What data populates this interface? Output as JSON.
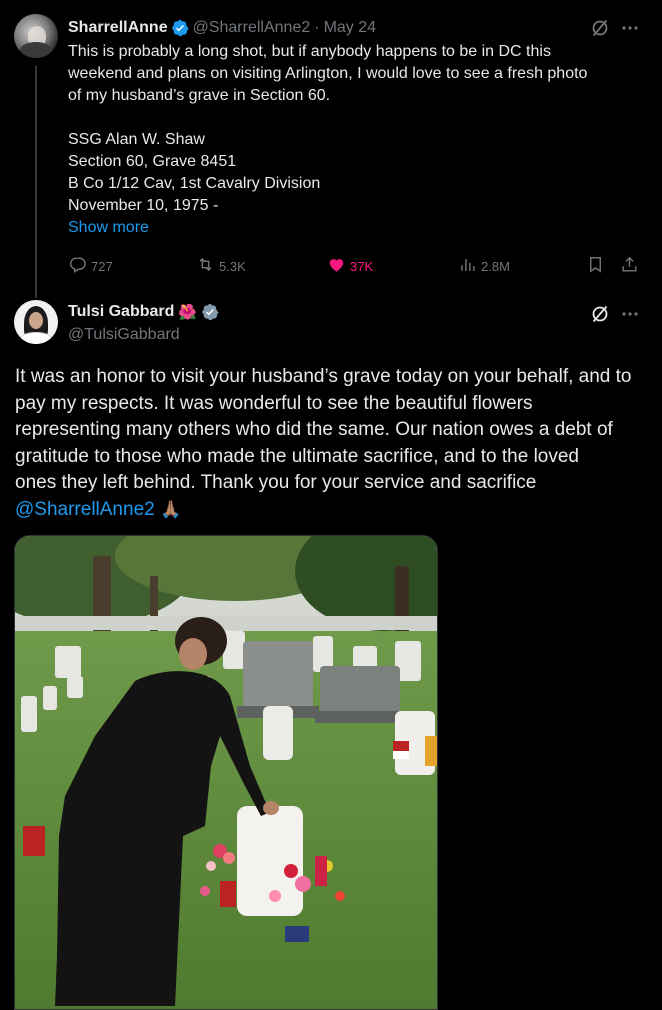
{
  "parent": {
    "name": "SharrellAnne",
    "handle": "@SharrellAnne2",
    "separator": "·",
    "date": "May 24",
    "lines": [
      "This is probably a long shot, but if anybody happens to be in DC this",
      "weekend and plans on visiting Arlington, I would love to see a fresh photo",
      "of my husband’s grave in Section 60."
    ],
    "details": [
      "SSG Alan W. Shaw",
      "Section 60, Grave 8451",
      "B Co 1/12 Cav, 1st Cavalry Division",
      "November 10, 1975 -"
    ],
    "show_more": "Show more",
    "stats": {
      "replies": "727",
      "reposts": "5.3K",
      "likes": "37K",
      "views": "2.8M"
    }
  },
  "reply": {
    "name": "Tulsi Gabbard",
    "flower_emoji": "🌺",
    "handle": "@TulsiGabbard",
    "lines": [
      "It was an honor to visit your husband’s grave today on your behalf, and to",
      "pay my respects. It was wonderful to see the beautiful flowers",
      "representing many others who did the same. Our nation owes a debt of",
      "gratitude to those who made the ultimate sacrifice, and to the loved",
      "ones they left behind.  Thank you for your service and sacrifice"
    ],
    "mention": "@SharrellAnne2",
    "pray_emoji": "🙏🏽"
  },
  "icons": {
    "verified": "verified-badge-icon",
    "grok": "grok-icon",
    "more": "more-icon",
    "reply": "reply-icon",
    "repost": "repost-icon",
    "like": "heart-icon",
    "views": "views-icon",
    "bookmark": "bookmark-icon",
    "share": "share-icon"
  },
  "colors": {
    "background": "#000000",
    "text": "#e7e9ea",
    "muted": "#71767b",
    "link": "#1d9bf0",
    "like": "#f91880",
    "verified_blue": "#1d9bf0",
    "verified_gray": "#829aab"
  }
}
